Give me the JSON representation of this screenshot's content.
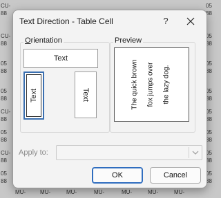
{
  "background": {
    "left_fragments": [
      "CU-",
      "88",
      "CU-",
      "88",
      "05",
      "88",
      "05",
      "88",
      "CU-",
      "88",
      "05",
      "88",
      "CU-",
      "88",
      "05",
      "88"
    ],
    "right_fragments": [
      "05",
      "88",
      "05",
      "88",
      "05",
      "88",
      "05",
      "88",
      "05",
      "88",
      "05",
      "88",
      "05",
      "88",
      "05",
      "88"
    ],
    "bottom_fragments": [
      "MU-",
      "MU-",
      "MU-",
      "MU-",
      "MU-",
      "MU-",
      "MU-"
    ]
  },
  "dialog": {
    "title": "Text Direction - Table Cell",
    "help_label": "?"
  },
  "orientation": {
    "label_underlined": "O",
    "label_rest": "rientation",
    "horizontal_text": "Text",
    "vertical_up_text": "Text",
    "vertical_down_text": "Text"
  },
  "preview": {
    "label": "Preview",
    "lines": [
      "The quick brown",
      "fox jumps over",
      "the lazy dog."
    ]
  },
  "apply": {
    "label": "Apply to:",
    "value": ""
  },
  "buttons": {
    "ok": "OK",
    "cancel": "Cancel"
  }
}
